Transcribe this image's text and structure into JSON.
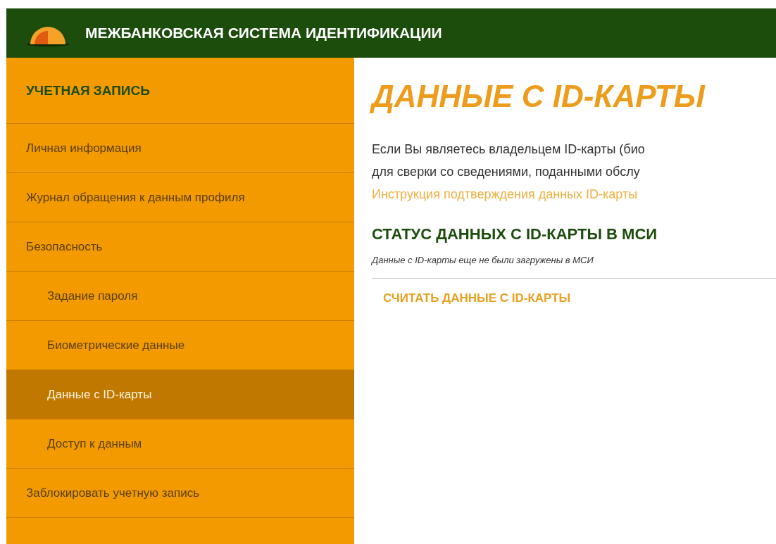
{
  "header": {
    "title": "МЕЖБАНКОВСКАЯ СИСТЕМА ИДЕНТИФИКАЦИИ"
  },
  "sidebar": {
    "heading": "УЧЕТНАЯ ЗАПИСЬ",
    "items": [
      {
        "label": "Личная информация",
        "selected": false
      },
      {
        "label": "Журнал обращения к данным профиля",
        "selected": false
      },
      {
        "label": "Безопасность",
        "selected": false,
        "children": [
          {
            "label": "Задание пароля",
            "selected": false
          },
          {
            "label": "Биометрические данные",
            "selected": false
          },
          {
            "label": "Данные с ID-карты",
            "selected": true
          },
          {
            "label": "Доступ к данным",
            "selected": false
          }
        ]
      },
      {
        "label": "Заблокировать учетную запись",
        "selected": false
      }
    ]
  },
  "main": {
    "title": "ДАННЫЕ С ID-КАРТЫ",
    "intro_lines": [
      "Если Вы являетесь владельцем ID-карты (био",
      "для сверки со сведениями, поданными обслу"
    ],
    "link": "Инструкция подтверждения данных ID-карты",
    "status_heading": "СТАТУС ДАННЫХ С ID-КАРТЫ В МСИ",
    "status_text": "Данные с ID-карты еще не были загружены в МСИ",
    "action": "СЧИТАТЬ ДАННЫЕ С ID-КАРТЫ"
  }
}
